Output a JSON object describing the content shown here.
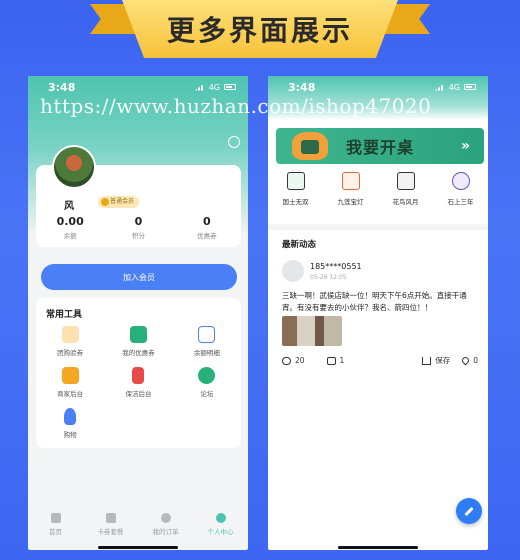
{
  "banner": {
    "title": "更多界面展示"
  },
  "watermark": "https://www.huzhan.com/ishop47020",
  "left_phone": {
    "status": {
      "time": "3:48",
      "network": "4G"
    },
    "profile": {
      "name": "风",
      "member_badge": "普通会员"
    },
    "stats": [
      {
        "value": "0.00",
        "label": "余额"
      },
      {
        "value": "0",
        "label": "积分"
      },
      {
        "value": "0",
        "label": "优惠券"
      }
    ],
    "join_button": "加入会员",
    "tools": {
      "title": "常用工具",
      "items": [
        {
          "label": "团购验券",
          "icon": "ticket-icon",
          "color": "#f5a623"
        },
        {
          "label": "我的优惠券",
          "icon": "coupon-icon",
          "color": "#27b07a"
        },
        {
          "label": "余额明细",
          "icon": "list-icon",
          "color": "#4a7ff5"
        },
        {
          "label": "商家后台",
          "icon": "shop-icon",
          "color": "#f5a623"
        },
        {
          "label": "保洁后台",
          "icon": "cleaning-icon",
          "color": "#e84a4a"
        },
        {
          "label": "论坛",
          "icon": "forum-icon",
          "color": "#27b07a"
        },
        {
          "label": "购物",
          "icon": "user-icon",
          "color": "#4a7ff5"
        }
      ]
    },
    "tabbar": [
      {
        "label": "首页",
        "icon": "home-icon",
        "active": false
      },
      {
        "label": "卡券套餐",
        "icon": "card-icon",
        "active": false
      },
      {
        "label": "我的订单",
        "icon": "clock-icon",
        "active": false
      },
      {
        "label": "个人中心",
        "icon": "person-icon",
        "active": true
      }
    ]
  },
  "right_phone": {
    "status": {
      "time": "3:48",
      "network": "4G"
    },
    "open_table": {
      "label": "我要开桌",
      "arrow": "»"
    },
    "games": [
      {
        "label": "国士无双",
        "icon": "mahjong-tile-icon",
        "color": "#2d8f5a"
      },
      {
        "label": "九莲宝灯",
        "icon": "lantern-icon",
        "color": "#e8683a"
      },
      {
        "label": "花鸟风月",
        "icon": "tile-icon",
        "color": "#333333"
      },
      {
        "label": "石上三年",
        "icon": "medal-icon",
        "color": "#6a4fc8"
      }
    ],
    "news": {
      "title": "最新动态",
      "post": {
        "user": "185****0551",
        "time": "05-26 12:05",
        "text": "三缺一啊！武侯店缺一位！明天下午6点开始。直接干通宵。有没有要去的小伙伴？我名、箭四位！！",
        "views": "20",
        "comments": "1",
        "save_label": "保存",
        "likes": "0"
      }
    }
  }
}
